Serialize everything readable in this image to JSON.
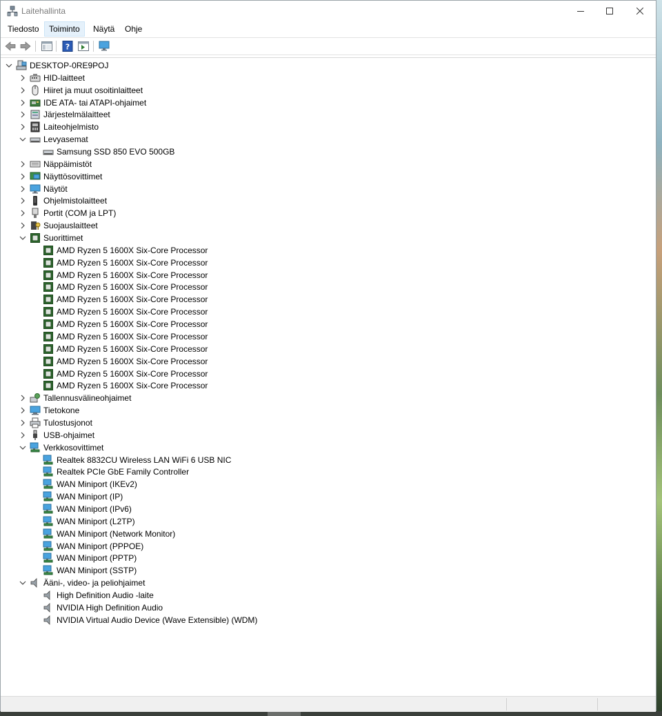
{
  "window": {
    "title": "Laitehallinta"
  },
  "menu": [
    "Tiedosto",
    "Toiminto",
    "Näytä",
    "Ohje"
  ],
  "toolbar": {
    "icons": [
      "back-arrow-icon",
      "forward-arrow-icon",
      "show-hide-tree-icon",
      "help-icon",
      "action-pane-icon",
      "monitor-icon"
    ]
  },
  "tree": {
    "root": "DESKTOP-0RE9POJ",
    "categories": [
      {
        "label": "HID-laitteet",
        "icon": "hid-icon",
        "expanded": false,
        "children": []
      },
      {
        "label": "Hiiret ja muut osoitinlaitteet",
        "icon": "mouse-icon",
        "expanded": false,
        "children": []
      },
      {
        "label": "IDE ATA- tai ATAPI-ohjaimet",
        "icon": "ide-icon",
        "expanded": false,
        "children": []
      },
      {
        "label": "Järjestelmälaitteet",
        "icon": "system-devices-icon",
        "expanded": false,
        "children": []
      },
      {
        "label": "Laiteohjelmisto",
        "icon": "firmware-icon",
        "expanded": false,
        "children": []
      },
      {
        "label": "Levyasemat",
        "icon": "disk-drive-icon",
        "expanded": true,
        "children": [
          "Samsung SSD 850 EVO 500GB"
        ]
      },
      {
        "label": "Näppäimistöt",
        "icon": "keyboard-icon",
        "expanded": false,
        "children": []
      },
      {
        "label": "Näyttösovittimet",
        "icon": "display-adapter-icon",
        "expanded": false,
        "children": []
      },
      {
        "label": "Näytöt",
        "icon": "monitor-icon",
        "expanded": false,
        "children": []
      },
      {
        "label": "Ohjelmistolaitteet",
        "icon": "software-device-icon",
        "expanded": false,
        "children": []
      },
      {
        "label": "Portit (COM ja LPT)",
        "icon": "port-icon",
        "expanded": false,
        "children": []
      },
      {
        "label": "Suojauslaitteet",
        "icon": "security-device-icon",
        "expanded": false,
        "children": []
      },
      {
        "label": "Suorittimet",
        "icon": "processor-icon",
        "expanded": true,
        "children": [
          "AMD Ryzen 5 1600X Six-Core Processor",
          "AMD Ryzen 5 1600X Six-Core Processor",
          "AMD Ryzen 5 1600X Six-Core Processor",
          "AMD Ryzen 5 1600X Six-Core Processor",
          "AMD Ryzen 5 1600X Six-Core Processor",
          "AMD Ryzen 5 1600X Six-Core Processor",
          "AMD Ryzen 5 1600X Six-Core Processor",
          "AMD Ryzen 5 1600X Six-Core Processor",
          "AMD Ryzen 5 1600X Six-Core Processor",
          "AMD Ryzen 5 1600X Six-Core Processor",
          "AMD Ryzen 5 1600X Six-Core Processor",
          "AMD Ryzen 5 1600X Six-Core Processor"
        ]
      },
      {
        "label": "Tallennusvälineohjaimet",
        "icon": "storage-controller-icon",
        "expanded": false,
        "children": []
      },
      {
        "label": "Tietokone",
        "icon": "computer-icon",
        "expanded": false,
        "children": []
      },
      {
        "label": "Tulostusjonot",
        "icon": "printer-icon",
        "expanded": false,
        "children": []
      },
      {
        "label": "USB-ohjaimet",
        "icon": "usb-icon",
        "expanded": false,
        "children": []
      },
      {
        "label": "Verkkosovittimet",
        "icon": "network-adapter-icon",
        "expanded": true,
        "children": [
          "Realtek 8832CU Wireless LAN WiFi 6 USB NIC",
          "Realtek PCIe GbE Family Controller",
          "WAN Miniport (IKEv2)",
          "WAN Miniport (IP)",
          "WAN Miniport (IPv6)",
          "WAN Miniport (L2TP)",
          "WAN Miniport (Network Monitor)",
          "WAN Miniport (PPPOE)",
          "WAN Miniport (PPTP)",
          "WAN Miniport (SSTP)"
        ]
      },
      {
        "label": "Ääni-, video- ja peliohjaimet",
        "icon": "audio-icon",
        "expanded": true,
        "children": [
          "High Definition Audio -laite",
          "NVIDIA High Definition Audio",
          "NVIDIA Virtual Audio Device (Wave Extensible) (WDM)"
        ]
      }
    ]
  }
}
